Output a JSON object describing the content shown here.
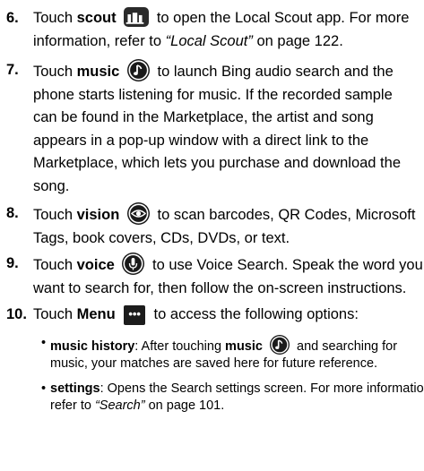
{
  "steps": [
    {
      "num": "6.",
      "lines": [
        {
          "pre": "Touch ",
          "bold": "scout",
          "icon": "scout-icon",
          "post": " to open the Local Scout app. For more"
        },
        {
          "pre": "information, refer to ",
          "ref": "“Local Scout”",
          "post": "  on page 122."
        }
      ]
    },
    {
      "num": "7.",
      "lines": [
        {
          "pre": "Touch ",
          "bold": "music",
          "icon": "music-icon",
          "post": " to launch Bing audio search and the"
        },
        {
          "text": "phone starts listening for music. If the recorded sample"
        },
        {
          "text": "can be found in the Marketplace, the artist and song"
        },
        {
          "text": "appears in a pop-up window with a direct link to the"
        },
        {
          "text": "Marketplace, which lets you purchase and download the"
        },
        {
          "text": "song."
        }
      ]
    },
    {
      "num": "8.",
      "lines": [
        {
          "pre": "Touch ",
          "bold": "vision",
          "icon": "vision-icon",
          "post": " to scan barcodes, QR Codes, Microsoft"
        },
        {
          "text": "Tags, book covers, CDs, DVDs, or text."
        }
      ]
    },
    {
      "num": "9.",
      "lines": [
        {
          "pre": "Touch ",
          "bold": "voice",
          "icon": "voice-icon",
          "post": " to use Voice Search. Speak the word you"
        },
        {
          "text": "want to search for, then follow the on-screen instructions."
        }
      ]
    },
    {
      "num": "10.",
      "lines": [
        {
          "pre": "Touch ",
          "bold": "Menu",
          "icon": "menu-dots-icon",
          "post": " to access the following options:"
        }
      ]
    }
  ],
  "menu_dots_glyph": "•••",
  "bullets": [
    {
      "lines": [
        {
          "bold": "music history",
          "pre": ": After touching ",
          "bold2": "music",
          "icon": "music-icon",
          "post": " and searching for"
        },
        {
          "text": "music, your matches are saved here for future reference."
        }
      ]
    },
    {
      "lines": [
        {
          "bold": "settings",
          "post": ": Opens the Search settings screen. For more information,"
        },
        {
          "pre": "refer to ",
          "ref": "“Search”",
          "post": "  on page 101."
        }
      ]
    }
  ]
}
